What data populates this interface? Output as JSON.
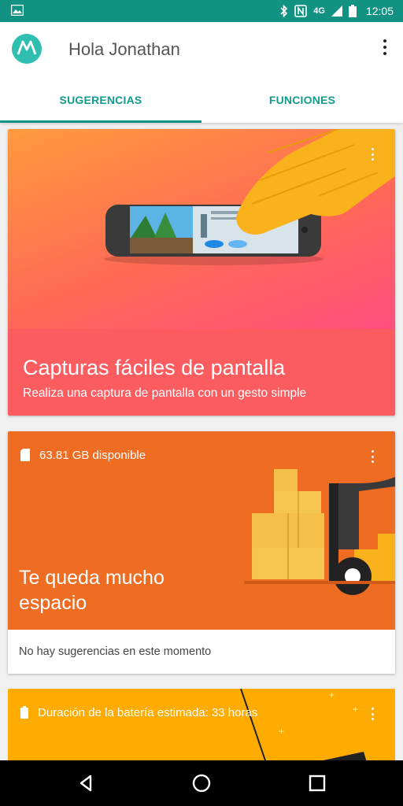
{
  "status_bar": {
    "time": "12:05",
    "network": "4G",
    "icons": [
      "image-notification-icon",
      "bluetooth-icon",
      "nfc-icon",
      "signal-icon",
      "battery-icon"
    ]
  },
  "app_bar": {
    "title": "Hola Jonathan",
    "logo": "motorola-logo",
    "menu_icon": "more-vert-icon"
  },
  "tabs": [
    {
      "label": "SUGERENCIAS",
      "active": true
    },
    {
      "label": "FUNCIONES",
      "active": false
    }
  ],
  "cards": {
    "screenshot": {
      "title": "Capturas fáciles de pantalla",
      "subtitle": "Realiza una captura de pantalla con un gesto simple",
      "menu_icon": "more-vert-icon"
    },
    "storage": {
      "status": "63.81 GB disponible",
      "title": "Te queda mucho espacio",
      "footer": "No hay sugerencias en este momento",
      "status_icon": "sd-card-icon",
      "menu_icon": "more-vert-icon"
    },
    "battery": {
      "status": "Duración de la batería estimada: 33 horas",
      "status_icon": "battery-icon",
      "menu_icon": "more-vert-icon"
    }
  },
  "nav_bar": {
    "buttons": [
      "back-icon",
      "home-icon",
      "recents-icon"
    ]
  },
  "colors": {
    "status_bar": "#129283",
    "accent": "#119b8c",
    "card1_gradient_start": "#ff9a3d",
    "card1_gradient_end": "#ff4f7e",
    "card1_bottom": "#fb5c60",
    "card2_bg": "#ef6c23",
    "card3_bg": "#ffab00"
  }
}
